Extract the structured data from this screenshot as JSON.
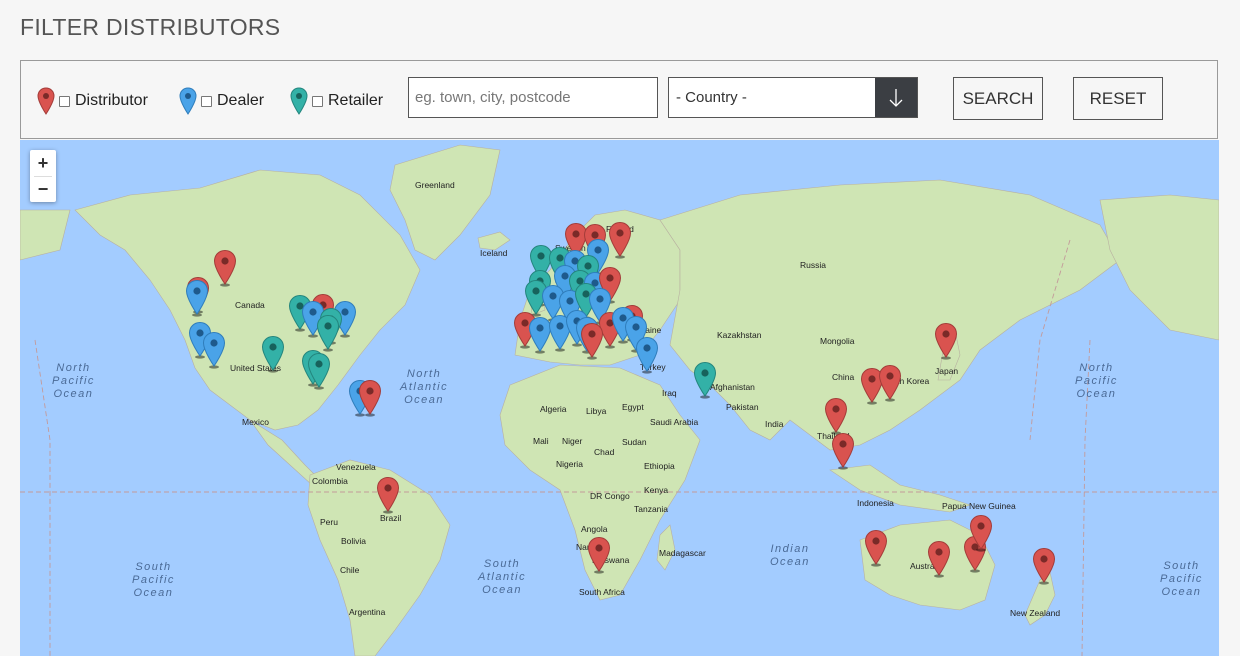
{
  "page": {
    "title": "FILTER DISTRIBUTORS"
  },
  "filters": {
    "options": [
      {
        "label": "Distributor",
        "color": "#d9534f",
        "icon": "map-pin-red"
      },
      {
        "label": "Dealer",
        "color": "#4aa3e8",
        "icon": "map-pin-blue"
      },
      {
        "label": "Retailer",
        "color": "#33b1a7",
        "icon": "map-pin-teal"
      }
    ],
    "search_placeholder": "eg. town, city, postcode",
    "country_value": "- Country -",
    "search_button": "SEARCH",
    "reset_button": "RESET"
  },
  "map": {
    "zoom_in": "+",
    "zoom_out": "−",
    "labels": [
      "Greenland",
      "Iceland",
      "Finland",
      "Sweden",
      "Russia",
      "Canada",
      "United States",
      "Mexico",
      "Kazakhstan",
      "Mongolia",
      "China",
      "South Korea",
      "Japan",
      "Afghanistan",
      "Pakistan",
      "Iraq",
      "Saudi Arabia",
      "India",
      "Thailand",
      "Algeria",
      "Libya",
      "Egypt",
      "Mali",
      "Niger",
      "Chad",
      "Sudan",
      "Nigeria",
      "Ethiopia",
      "Kenya",
      "DR Congo",
      "Tanzania",
      "Angola",
      "Namibia",
      "Botswana",
      "Madagascar",
      "South Africa",
      "Venezuela",
      "Colombia",
      "Peru",
      "Brazil",
      "Bolivia",
      "Chile",
      "Argentina",
      "Indonesia",
      "Papua New Guinea",
      "Australia",
      "New Zealand",
      "Ukraine",
      "Turkey"
    ],
    "oceans": [
      "North Pacific Ocean",
      "North Atlantic Ocean",
      "South Pacific Ocean",
      "South Atlantic Ocean",
      "Indian Ocean",
      "North Pacific Ocean",
      "South Pacific Ocean"
    ]
  }
}
